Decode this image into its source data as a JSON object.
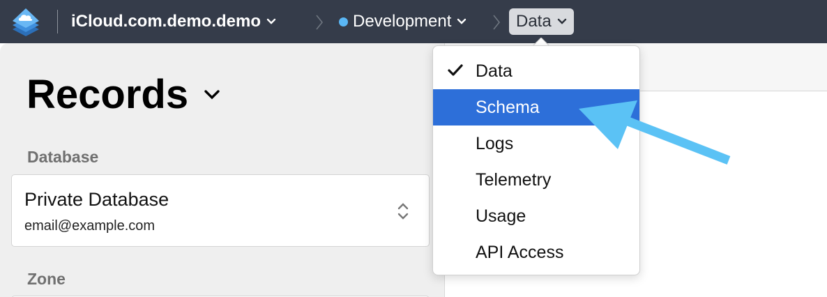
{
  "topbar": {
    "container_name": "iCloud.com.demo.demo",
    "environment": "Development",
    "section": "Data"
  },
  "page": {
    "title": "Records"
  },
  "database": {
    "label": "Database",
    "selected_name": "Private Database",
    "selected_account": "email@example.com"
  },
  "zone": {
    "label": "Zone"
  },
  "menu": {
    "items": [
      {
        "label": "Data",
        "checked": true
      },
      {
        "label": "Schema",
        "highlighted": true
      },
      {
        "label": "Logs"
      },
      {
        "label": "Telemetry"
      },
      {
        "label": "Usage"
      },
      {
        "label": "API Access"
      }
    ]
  },
  "colors": {
    "topbar": "#353c4a",
    "menu_highlight": "#2d6fd9",
    "environment_dot": "#5ab7f5",
    "annotation_arrow": "#5bc2f5"
  },
  "icons": {
    "app": "cloudkit-app-icon",
    "check": "checkmark-icon",
    "updown": "up-down-chevron-icon",
    "breadcrumb_separator": "chevron-right-icon"
  }
}
